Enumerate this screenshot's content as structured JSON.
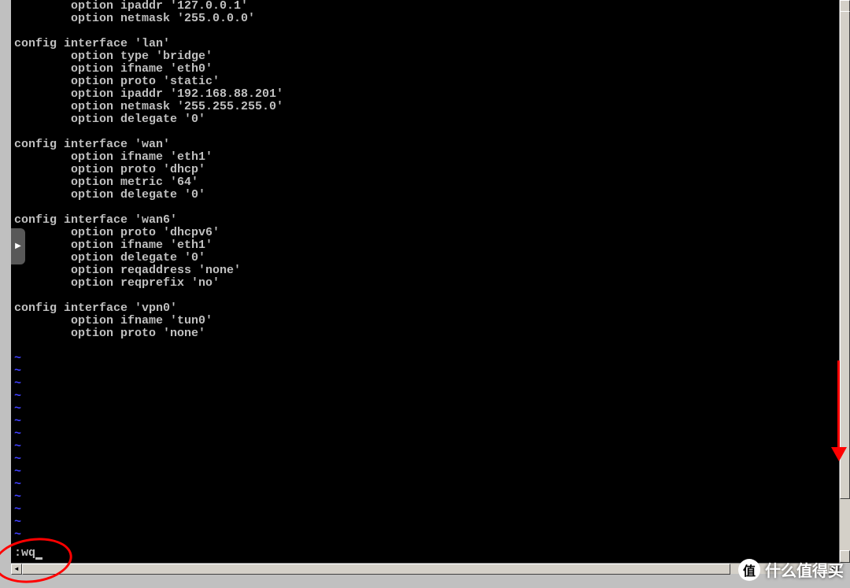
{
  "terminal": {
    "partial_lines": [
      "        option ipaddr '127.0.0.1'",
      "        option netmask '255.0.0.0'"
    ],
    "blocks": [
      {
        "header": "config interface 'lan'",
        "options": [
          "        option type 'bridge'",
          "        option ifname 'eth0'",
          "        option proto 'static'",
          "        option ipaddr '192.168.88.201'",
          "        option netmask '255.255.255.0'",
          "        option delegate '0'"
        ]
      },
      {
        "header": "config interface 'wan'",
        "options": [
          "        option ifname 'eth1'",
          "        option proto 'dhcp'",
          "        option metric '64'",
          "        option delegate '0'"
        ]
      },
      {
        "header": "config interface 'wan6'",
        "options": [
          "        option proto 'dhcpv6'",
          "        option ifname 'eth1'",
          "        option delegate '0'",
          "        option reqaddress 'none'",
          "        option reqprefix 'no'"
        ]
      },
      {
        "header": "config interface 'vpn0'",
        "options": [
          "        option ifname 'tun0'",
          "        option proto 'none'"
        ]
      }
    ],
    "tilde_count": 15,
    "command": ":wq"
  },
  "side_tab": {
    "glyph": "▶"
  },
  "watermark": {
    "logo_char": "值",
    "text": "什么值得买"
  }
}
